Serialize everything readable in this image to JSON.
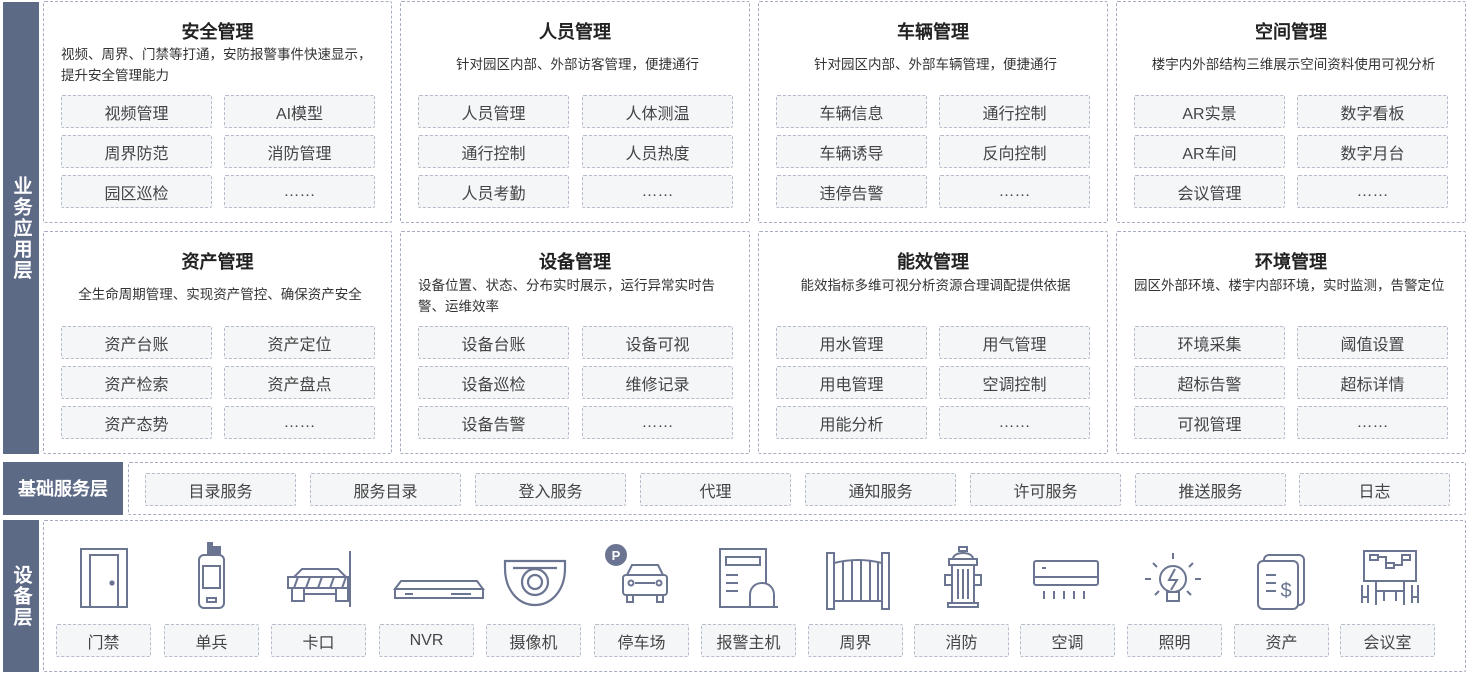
{
  "layers": {
    "business": "业务应用层",
    "foundation": "基础服务层",
    "device": "设备层"
  },
  "modules": [
    {
      "title": "安全管理",
      "desc": "视频、周界、门禁等打通，安防报警事件快速显示，提升安全管理能力",
      "items": [
        "视频管理",
        "AI模型",
        "周界防范",
        "消防管理",
        "园区巡检",
        "……"
      ]
    },
    {
      "title": "人员管理",
      "desc": "针对园区内部、外部访客管理，便捷通行",
      "items": [
        "人员管理",
        "人体测温",
        "通行控制",
        "人员热度",
        "人员考勤",
        "……"
      ]
    },
    {
      "title": "车辆管理",
      "desc": "针对园区内部、外部车辆管理，便捷通行",
      "items": [
        "车辆信息",
        "通行控制",
        "车辆诱导",
        "反向控制",
        "违停告警",
        "……"
      ]
    },
    {
      "title": "空间管理",
      "desc": "楼宇内外部结构三维展示空间资料使用可视分析",
      "items": [
        "AR实景",
        "数字看板",
        "AR车间",
        "数字月台",
        "会议管理",
        "……"
      ]
    },
    {
      "title": "资产管理",
      "desc": "全生命周期管理、实现资产管控、确保资产安全",
      "items": [
        "资产台账",
        "资产定位",
        "资产检索",
        "资产盘点",
        "资产态势",
        "……"
      ]
    },
    {
      "title": "设备管理",
      "desc": "设备位置、状态、分布实时展示，运行异常实时告警、运维效率",
      "items": [
        "设备台账",
        "设备可视",
        "设备巡检",
        "维修记录",
        "设备告警",
        "……"
      ]
    },
    {
      "title": "能效管理",
      "desc": "能效指标多维可视分析资源合理调配提供依据",
      "items": [
        "用水管理",
        "用气管理",
        "用电管理",
        "空调控制",
        "用能分析",
        "……"
      ]
    },
    {
      "title": "环境管理",
      "desc": "园区外部环境、楼宇内部环境，实时监测，告警定位",
      "items": [
        "环境采集",
        "阈值设置",
        "超标告警",
        "超标详情",
        "可视管理",
        "……"
      ]
    }
  ],
  "services": [
    "目录服务",
    "服务目录",
    "登入服务",
    "代理",
    "通知服务",
    "许可服务",
    "推送服务",
    "日志"
  ],
  "devices": [
    {
      "label": "门禁",
      "icon": "door-icon"
    },
    {
      "label": "单兵",
      "icon": "walkie-talkie-icon"
    },
    {
      "label": "卡口",
      "icon": "barrier-gate-icon"
    },
    {
      "label": "NVR",
      "icon": "nvr-icon"
    },
    {
      "label": "摄像机",
      "icon": "dome-camera-icon"
    },
    {
      "label": "停车场",
      "icon": "parking-car-icon"
    },
    {
      "label": "报警主机",
      "icon": "alarm-host-icon"
    },
    {
      "label": "周界",
      "icon": "fence-icon"
    },
    {
      "label": "消防",
      "icon": "fire-hydrant-icon"
    },
    {
      "label": "空调",
      "icon": "air-conditioner-icon"
    },
    {
      "label": "照明",
      "icon": "light-bulb-icon"
    },
    {
      "label": "资产",
      "icon": "asset-document-icon"
    },
    {
      "label": "会议室",
      "icon": "meeting-room-icon"
    }
  ],
  "colors": {
    "layer_bg": "#5d6a86",
    "icon_stroke": "#6b7591",
    "chip_bg": "#f5f6f8",
    "border": "#a6adc1"
  }
}
